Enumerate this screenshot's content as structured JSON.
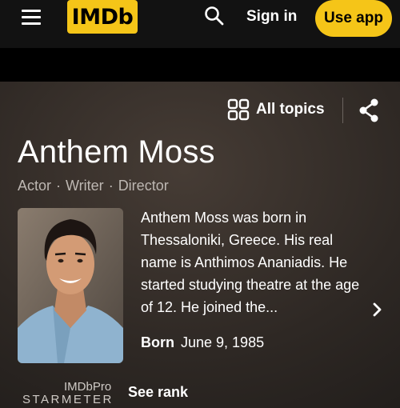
{
  "nav": {
    "menu_icon": "hamburger-menu-icon",
    "logo": "IMDb",
    "search_icon": "search-icon",
    "sign_in": "Sign in",
    "use_app": "Use app"
  },
  "colors": {
    "brand_yellow": "#f5c518",
    "background": "#121212"
  },
  "hero": {
    "all_topics_icon": "grid-icon",
    "all_topics": "All topics",
    "share_icon": "share-icon",
    "name": "Anthem Moss",
    "roles": [
      "Actor",
      "Writer",
      "Director"
    ],
    "bio": "Anthem Moss was born in Thessaloniki, Greece. His real name is Anthimos Ananiadis. He started studying theatre at the age of 12. He joined the...",
    "chevron_icon": "chevron-right-icon",
    "born_label": "Born",
    "born_date": "June 9, 1985",
    "starmeter_pro": "IMDbPro",
    "starmeter_label": "STARMETER",
    "see_rank": "See rank"
  }
}
